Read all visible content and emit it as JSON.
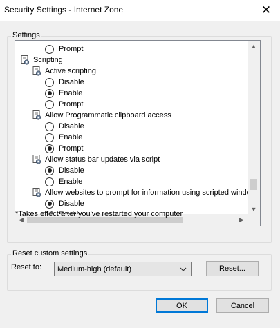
{
  "window": {
    "title": "Security Settings - Internet Zone",
    "close_glyph": "✕"
  },
  "settings_group": {
    "legend": "Settings",
    "items": [
      {
        "type": "option",
        "label": "Prompt",
        "checked": false
      },
      {
        "type": "category",
        "label": "Scripting",
        "icon": "settings-page-icon"
      },
      {
        "type": "setting",
        "label": "Active scripting",
        "icon": "settings-page-icon"
      },
      {
        "type": "option",
        "label": "Disable",
        "checked": false
      },
      {
        "type": "option",
        "label": "Enable",
        "checked": true
      },
      {
        "type": "option",
        "label": "Prompt",
        "checked": false
      },
      {
        "type": "setting",
        "label": "Allow Programmatic clipboard access",
        "icon": "settings-page-icon"
      },
      {
        "type": "option",
        "label": "Disable",
        "checked": false
      },
      {
        "type": "option",
        "label": "Enable",
        "checked": false
      },
      {
        "type": "option",
        "label": "Prompt",
        "checked": true
      },
      {
        "type": "setting",
        "label": "Allow status bar updates via script",
        "icon": "settings-page-icon"
      },
      {
        "type": "option",
        "label": "Disable",
        "checked": true
      },
      {
        "type": "option",
        "label": "Enable",
        "checked": false
      },
      {
        "type": "setting",
        "label": "Allow websites to prompt for information using scripted windo",
        "icon": "settings-page-icon"
      },
      {
        "type": "option",
        "label": "Disable",
        "checked": true
      },
      {
        "type": "option",
        "label": "Enable",
        "checked": false
      }
    ],
    "footnote": "*Takes effect after you've restarted your computer"
  },
  "reset_group": {
    "legend": "Reset custom settings",
    "reset_to_label": "Reset to:",
    "selected_level": "Medium-high (default)",
    "reset_button": "Reset..."
  },
  "buttons": {
    "ok": "OK",
    "cancel": "Cancel"
  },
  "colors": {
    "accent": "#0078d7",
    "dialog_bg": "#f0f0f0",
    "button_bg": "#e1e1e1"
  }
}
